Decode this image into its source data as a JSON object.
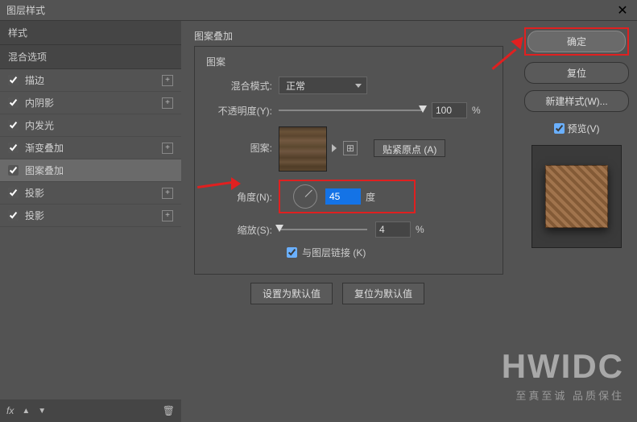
{
  "titlebar": {
    "title": "图层样式"
  },
  "left": {
    "styles_header": "样式",
    "blend_header": "混合选项",
    "items": [
      {
        "label": "描边",
        "checked": true,
        "add": true
      },
      {
        "label": "内阴影",
        "checked": true,
        "add": true
      },
      {
        "label": "内发光",
        "checked": true,
        "add": false
      },
      {
        "label": "渐变叠加",
        "checked": true,
        "add": true
      },
      {
        "label": "图案叠加",
        "checked": true,
        "add": false,
        "active": true
      },
      {
        "label": "投影",
        "checked": true,
        "add": true
      },
      {
        "label": "投影",
        "checked": true,
        "add": true
      }
    ],
    "footer_fx": "fx"
  },
  "center": {
    "section": "图案叠加",
    "group": "图案",
    "blend_mode_label": "混合模式:",
    "blend_mode_value": "正常",
    "opacity_label": "不透明度(Y):",
    "opacity_value": "100",
    "opacity_unit": "%",
    "pattern_label": "图案:",
    "snap_origin": "贴紧原点 (A)",
    "angle_label": "角度(N):",
    "angle_value": "45",
    "angle_unit": "度",
    "scale_label": "缩放(S):",
    "scale_value": "4",
    "scale_unit": "%",
    "link_label": "与图层链接 (K)",
    "make_default": "设置为默认值",
    "reset_default": "复位为默认值"
  },
  "right": {
    "ok": "确定",
    "reset": "复位",
    "new_style": "新建样式(W)...",
    "preview": "预览(V)"
  },
  "watermark": {
    "big": "HWIDC",
    "small": "至真至诚 品质保住"
  }
}
